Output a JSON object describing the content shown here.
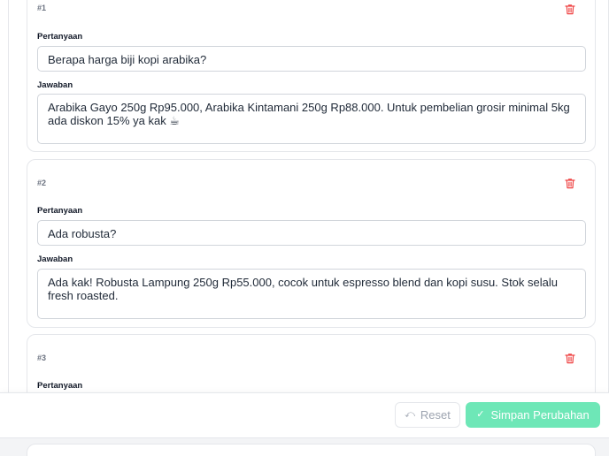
{
  "colors": {
    "trash": "#ef4444",
    "save_bg": "#6ee7b7",
    "border": "#e5e7eb"
  },
  "faqs": [
    {
      "number": "#1",
      "question_label": "Pertanyaan",
      "question": "Berapa harga biji kopi arabika?",
      "answer_label": "Jawaban",
      "answer": "Arabika Gayo 250g Rp95.000, Arabika Kintamani 250g Rp88.000. Untuk pembelian grosir minimal 5kg ada diskon 15% ya kak ☕",
      "delete_icon": "trash-icon"
    },
    {
      "number": "#2",
      "question_label": "Pertanyaan",
      "question": "Ada robusta?",
      "answer_label": "Jawaban",
      "answer": "Ada kak! Robusta Lampung 250g Rp55.000, cocok untuk espresso blend dan kopi susu. Stok selalu fresh roasted.",
      "delete_icon": "trash-icon"
    },
    {
      "number": "#3",
      "question_label": "Pertanyaan",
      "delete_icon": "trash-icon"
    }
  ],
  "footer": {
    "reset_label": "Reset",
    "reset_icon": "undo-icon",
    "save_label": "Simpan Perubahan",
    "save_icon": "check-icon"
  }
}
